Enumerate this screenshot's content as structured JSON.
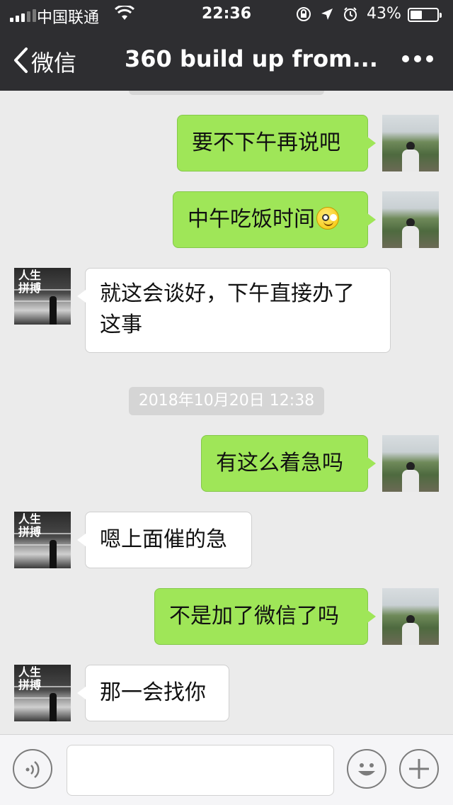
{
  "status_bar": {
    "carrier": "中国联通",
    "time": "22:36",
    "battery_percent": "43%",
    "battery_level": 0.43,
    "icons": [
      "signal-icon",
      "wifi-icon",
      "orientation-lock-icon",
      "location-icon",
      "alarm-icon",
      "battery-icon"
    ]
  },
  "nav": {
    "back_label": "微信",
    "title": "360 build up from...",
    "more_icon": "more-icon"
  },
  "messages": [
    {
      "side": "me",
      "text": "要不下午再说吧"
    },
    {
      "side": "me",
      "text": "中午吃饭时间",
      "emoji": "smiley-icon"
    },
    {
      "side": "them",
      "line1": "就这会谈好，下午直接办了",
      "line2": "这事"
    },
    {
      "side": "me",
      "text": "有这么着急吗"
    },
    {
      "side": "them",
      "text": "嗯上面催的急"
    },
    {
      "side": "me",
      "text": "不是加了微信了吗"
    },
    {
      "side": "them",
      "text": "那一会找你"
    }
  ],
  "timestamp": "2018年10月20日 12:38",
  "avatars": {
    "them_text_line1": "人生",
    "them_text_line2": "拼搏"
  },
  "toolbar": {
    "voice_icon": "voice-icon",
    "emoji_icon": "emoji-icon",
    "plus_icon": "plus-icon",
    "input_value": ""
  }
}
